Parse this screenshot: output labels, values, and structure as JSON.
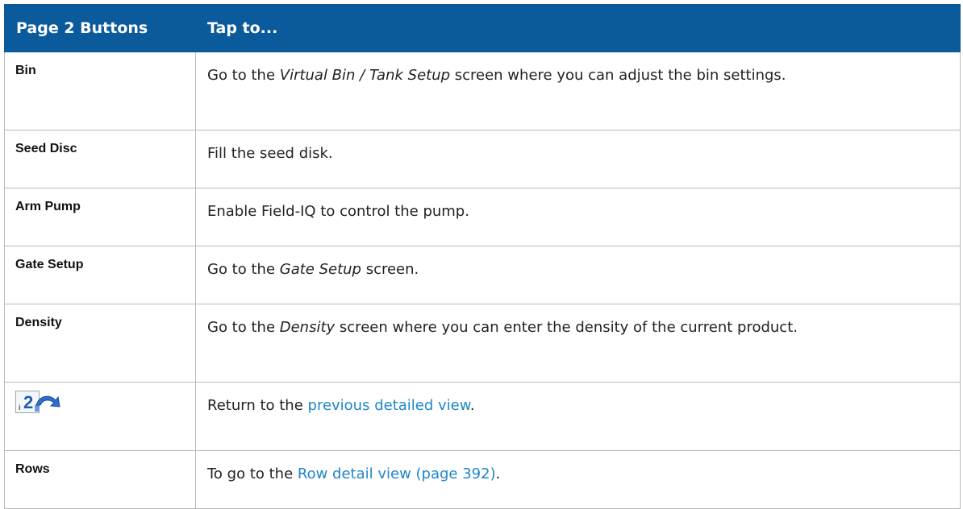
{
  "header": {
    "col1": "Page 2 Buttons",
    "col2": "Tap to..."
  },
  "rows": [
    {
      "button": "Bin",
      "pre": "Go to the ",
      "em": "Virtual Bin / Tank Setup",
      "post": " screen where you can adjust the bin settings."
    },
    {
      "button": "Seed Disc",
      "text": "Fill the seed disk."
    },
    {
      "button": "Arm Pump",
      "text": "Enable Field-IQ to control the pump."
    },
    {
      "button": "Gate Setup",
      "pre": "Go to the ",
      "em": "Gate Setup",
      "post": " screen."
    },
    {
      "button": "Density",
      "pre": "Go to the ",
      "em": "Density",
      "post": " screen where you can enter the density of the current product."
    },
    {
      "icon": "page-2-return-icon",
      "pre": "Return to the ",
      "link": "previous detailed view",
      "post": "."
    },
    {
      "button": "Rows",
      "pre": "To go to the ",
      "link": "Row detail view (page 392)",
      "post": "."
    }
  ],
  "colors": {
    "header_bg": "#0a5a9c",
    "link": "#1f86c8",
    "border": "#b9b9b9"
  }
}
